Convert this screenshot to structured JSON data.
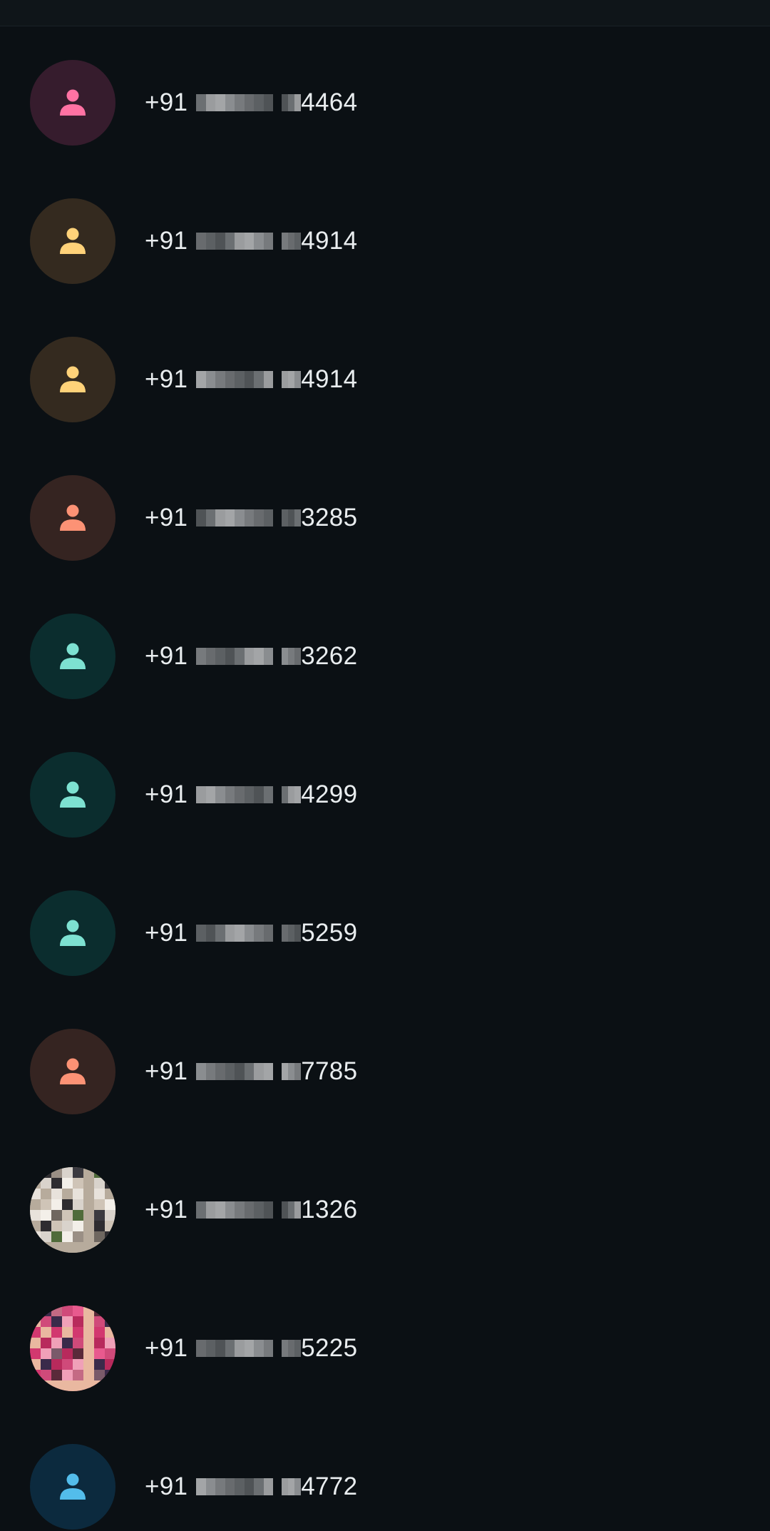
{
  "contacts": [
    {
      "country_code": "+91",
      "suffix": "4464",
      "avatar": {
        "type": "default-person-icon",
        "bg": "#361c2d",
        "fg": "#ff72a3"
      }
    },
    {
      "country_code": "+91",
      "suffix": "4914",
      "avatar": {
        "type": "default-person-icon",
        "bg": "#342a1f",
        "fg": "#ffd279"
      }
    },
    {
      "country_code": "+91",
      "suffix": "4914",
      "avatar": {
        "type": "default-person-icon",
        "bg": "#342a1f",
        "fg": "#ffd279"
      }
    },
    {
      "country_code": "+91",
      "suffix": "3285",
      "avatar": {
        "type": "default-person-icon",
        "bg": "#352421",
        "fg": "#fc9275"
      }
    },
    {
      "country_code": "+91",
      "suffix": "3262",
      "avatar": {
        "type": "default-person-icon",
        "bg": "#0b2d2e",
        "fg": "#7de1d1"
      }
    },
    {
      "country_code": "+91",
      "suffix": "4299",
      "avatar": {
        "type": "default-person-icon",
        "bg": "#0b2d2e",
        "fg": "#7de1d1"
      }
    },
    {
      "country_code": "+91",
      "suffix": "5259",
      "avatar": {
        "type": "default-person-icon",
        "bg": "#0b2d2e",
        "fg": "#7de1d1"
      }
    },
    {
      "country_code": "+91",
      "suffix": "7785",
      "avatar": {
        "type": "default-person-icon",
        "bg": "#352421",
        "fg": "#fc9275"
      }
    },
    {
      "country_code": "+91",
      "suffix": "1326",
      "avatar": {
        "type": "profile-photo",
        "bg": "#c9b7a6"
      }
    },
    {
      "country_code": "+91",
      "suffix": "5225",
      "avatar": {
        "type": "profile-photo",
        "bg": "#c4336a"
      }
    },
    {
      "country_code": "+91",
      "suffix": "4772",
      "avatar": {
        "type": "default-person-icon",
        "bg": "#0c2a3e",
        "fg": "#53bdeb"
      }
    }
  ]
}
